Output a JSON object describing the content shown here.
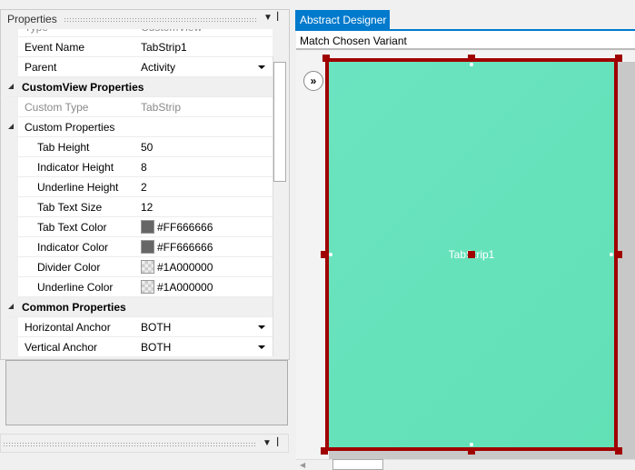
{
  "properties": {
    "title": "Properties",
    "rows": [
      {
        "kind": "prop",
        "level": 0,
        "readonly": true,
        "label": "Type",
        "value": "CustomView"
      },
      {
        "kind": "prop",
        "level": 0,
        "label": "Event Name",
        "value": "TabStrip1"
      },
      {
        "kind": "prop",
        "level": 0,
        "label": "Parent",
        "value": "Activity",
        "dropdown": true
      },
      {
        "kind": "cat",
        "label": "CustomView Properties"
      },
      {
        "kind": "prop",
        "level": 0,
        "readonly": true,
        "label": "Custom Type",
        "value": "TabStrip"
      },
      {
        "kind": "sub",
        "label": "Custom Properties"
      },
      {
        "kind": "prop",
        "level": 1,
        "label": "Tab Height",
        "value": "50"
      },
      {
        "kind": "prop",
        "level": 1,
        "label": "Indicator Height",
        "value": "8"
      },
      {
        "kind": "prop",
        "level": 1,
        "label": "Underline Height",
        "value": "2"
      },
      {
        "kind": "prop",
        "level": 1,
        "label": "Tab Text Size",
        "value": "12"
      },
      {
        "kind": "prop",
        "level": 1,
        "label": "Tab Text Color",
        "value": "#FF666666",
        "swatch": "#666666"
      },
      {
        "kind": "prop",
        "level": 1,
        "label": "Indicator Color",
        "value": "#FF666666",
        "swatch": "#666666"
      },
      {
        "kind": "prop",
        "level": 1,
        "label": "Divider Color",
        "value": "#1A000000",
        "swatch": "checker"
      },
      {
        "kind": "prop",
        "level": 1,
        "label": "Underline Color",
        "value": "#1A000000",
        "swatch": "checker"
      },
      {
        "kind": "cat",
        "label": "Common Properties"
      },
      {
        "kind": "prop",
        "level": 0,
        "label": "Horizontal Anchor",
        "value": "BOTH",
        "dropdown": true
      },
      {
        "kind": "prop",
        "level": 0,
        "label": "Vertical Anchor",
        "value": "BOTH",
        "dropdown": true
      },
      {
        "kind": "prop",
        "level": 0,
        "label": "",
        "value": ""
      }
    ]
  },
  "designer": {
    "tab_label": "Abstract Designer",
    "variant": "Match Chosen Variant",
    "view_label": "TabStrip1",
    "colors": {
      "view_fill": "#66e2bb",
      "selection": "#a00000",
      "accent": "#007acc"
    }
  }
}
